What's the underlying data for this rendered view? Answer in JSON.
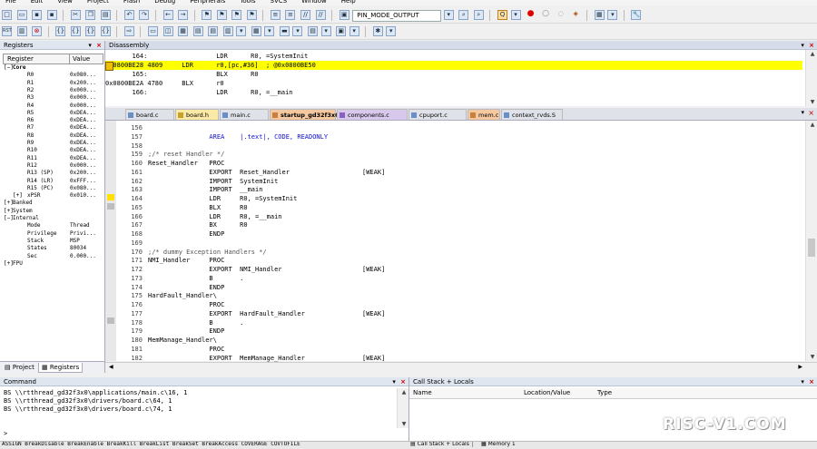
{
  "menu": [
    "File",
    "Edit",
    "View",
    "Project",
    "Flash",
    "Debug",
    "Peripherals",
    "Tools",
    "SVCS",
    "Window",
    "Help"
  ],
  "toolbar": {
    "target": "PIN_MODE_OUTPUT",
    "rst_label": "RST"
  },
  "registers": {
    "title": "Registers",
    "col_register": "Register",
    "col_value": "Value",
    "rows": [
      {
        "name": "Core",
        "value": "",
        "indent": 1,
        "bold": true,
        "expander": "−"
      },
      {
        "name": "R0",
        "value": "0x080...",
        "indent": 3
      },
      {
        "name": "R1",
        "value": "0x200...",
        "indent": 3
      },
      {
        "name": "R2",
        "value": "0x000...",
        "indent": 3
      },
      {
        "name": "R3",
        "value": "0x000...",
        "indent": 3
      },
      {
        "name": "R4",
        "value": "0x000...",
        "indent": 3
      },
      {
        "name": "R5",
        "value": "0xDEA...",
        "indent": 3
      },
      {
        "name": "R6",
        "value": "0xDEA...",
        "indent": 3
      },
      {
        "name": "R7",
        "value": "0xDEA...",
        "indent": 3
      },
      {
        "name": "R8",
        "value": "0xDEA...",
        "indent": 3
      },
      {
        "name": "R9",
        "value": "0xDEA...",
        "indent": 3
      },
      {
        "name": "R10",
        "value": "0xDEA...",
        "indent": 3
      },
      {
        "name": "R11",
        "value": "0xDEA...",
        "indent": 3
      },
      {
        "name": "R12",
        "value": "0x000...",
        "indent": 3
      },
      {
        "name": "R13 (SP)",
        "value": "0x200...",
        "indent": 3
      },
      {
        "name": "R14 (LR)",
        "value": "0xFFF...",
        "indent": 3
      },
      {
        "name": "R15 (PC)",
        "value": "0x080...",
        "indent": 3
      },
      {
        "name": "xPSR",
        "value": "0x010...",
        "indent": 3,
        "expander": "+"
      },
      {
        "name": "Banked",
        "value": "",
        "indent": 1,
        "expander": "+"
      },
      {
        "name": "System",
        "value": "",
        "indent": 1,
        "expander": "+"
      },
      {
        "name": "Internal",
        "value": "",
        "indent": 1,
        "expander": "−"
      },
      {
        "name": "Mode",
        "value": "Thread",
        "indent": 3
      },
      {
        "name": "Privilege",
        "value": "Privi...",
        "indent": 3
      },
      {
        "name": "Stack",
        "value": "MSP",
        "indent": 3
      },
      {
        "name": "States",
        "value": "80034",
        "indent": 3
      },
      {
        "name": "Sec",
        "value": "0.000...",
        "indent": 3
      },
      {
        "name": "FPU",
        "value": "",
        "indent": 1,
        "expander": "+"
      }
    ],
    "tab_project": "Project",
    "tab_registers": "Registers"
  },
  "disassembly": {
    "title": "Disassembly",
    "lines": [
      {
        "text": "       164:                  LDR      R0, =SystemInit",
        "highlight": false
      },
      {
        "text": "0x0800BE28 4809     LDR      r0,[pc,#36]  ; @0x0800BE50",
        "highlight": true
      },
      {
        "text": "       165:                  BLX      R0",
        "highlight": false
      },
      {
        "text": "0x0800BE2A 4780     BLX      r0",
        "highlight": false
      },
      {
        "text": "       166:                  LDR      R0, =__main",
        "highlight": false
      }
    ]
  },
  "tabs": [
    {
      "label": "board.c",
      "color": "#dfe2e8",
      "icon": "#6a8fc8"
    },
    {
      "label": "board.h",
      "color": "#fbe9a6",
      "icon": "#c8a030"
    },
    {
      "label": "main.c",
      "color": "#dfe2e8",
      "icon": "#6a8fc8"
    },
    {
      "label": "startup_gd32f3x0.s",
      "color": "#f5c8a0",
      "icon": "#c88040",
      "active": true
    },
    {
      "label": "components.c",
      "color": "#d8c8ec",
      "icon": "#8860c0"
    },
    {
      "label": "cpuport.c",
      "color": "#dfe2e8",
      "icon": "#6a8fc8"
    },
    {
      "label": "mem.c",
      "color": "#f5c8a0",
      "icon": "#c88040"
    },
    {
      "label": "context_rvds.S",
      "color": "#dfe2e8",
      "icon": "#6a8fc8"
    }
  ],
  "code": [
    {
      "ln": "156",
      "t": ""
    },
    {
      "ln": "157",
      "t": "                AREA    |.text|, CODE, READONLY",
      "c": "kw"
    },
    {
      "ln": "158",
      "t": ""
    },
    {
      "ln": "159",
      "t": ";/* reset Handler */",
      "c": "cm"
    },
    {
      "ln": "160",
      "t": "Reset_Handler   PROC"
    },
    {
      "ln": "161",
      "t": "                EXPORT  Reset_Handler                   [WEAK]"
    },
    {
      "ln": "162",
      "t": "                IMPORT  SystemInit"
    },
    {
      "ln": "163",
      "t": "                IMPORT  __main"
    },
    {
      "ln": "164",
      "t": "                LDR     R0, =SystemInit"
    },
    {
      "ln": "165",
      "t": "                BLX     R0"
    },
    {
      "ln": "166",
      "t": "                LDR     R0, =__main"
    },
    {
      "ln": "167",
      "t": "                BX      R0"
    },
    {
      "ln": "168",
      "t": "                ENDP"
    },
    {
      "ln": "169",
      "t": ""
    },
    {
      "ln": "170",
      "t": ";/* dummy Exception Handlers */",
      "c": "cm"
    },
    {
      "ln": "171",
      "t": "NMI_Handler     PROC"
    },
    {
      "ln": "172",
      "t": "                EXPORT  NMI_Handler                     [WEAK]"
    },
    {
      "ln": "173",
      "t": "                B       ."
    },
    {
      "ln": "174",
      "t": "                ENDP"
    },
    {
      "ln": "175",
      "t": "HardFault_Handler\\"
    },
    {
      "ln": "176",
      "t": "                PROC"
    },
    {
      "ln": "177",
      "t": "                EXPORT  HardFault_Handler               [WEAK]"
    },
    {
      "ln": "178",
      "t": "                B       ."
    },
    {
      "ln": "179",
      "t": "                ENDP"
    },
    {
      "ln": "180",
      "t": "MemManage_Handler\\"
    },
    {
      "ln": "181",
      "t": "                PROC"
    },
    {
      "ln": "182",
      "t": "                EXPORT  MemManage_Handler               [WEAK]"
    }
  ],
  "command": {
    "title": "Command",
    "lines": [
      "BS \\\\rtthread_gd32f3x0\\applications/main.c\\16, 1",
      "BS \\\\rtthread_gd32f3x0\\drivers/board.c\\64, 1",
      "BS \\\\rtthread_gd32f3x0\\drivers/board.c\\74, 1"
    ],
    "prompt": ">",
    "hint": "ASSIGN BreakDisable BreakEnable BreakKill BreakList BreakSet BreakAccess COVERAGE COVTOFILE"
  },
  "callstack": {
    "title": "Call Stack + Locals",
    "col_name": "Name",
    "col_location": "Location/Value",
    "col_type": "Type",
    "tab_callstack": "Call Stack + Locals",
    "tab_memory": "Memory 1"
  },
  "watermark": "RISC-V1.COM"
}
